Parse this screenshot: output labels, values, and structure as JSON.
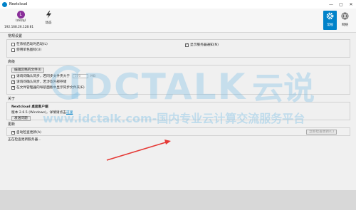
{
  "window": {
    "title": "Nextcloud",
    "controls": [
      "—",
      "▢",
      "✕"
    ]
  },
  "toolbar": {
    "account": {
      "avatar_letter": "L",
      "name": "lzlilzql",
      "host": "192.168.26.128:81"
    },
    "activity_label": "动态",
    "general_label": "常规",
    "network_label": "网络"
  },
  "general_settings": {
    "title": "常规设置",
    "launch_on_start": "在系统启动时启动(L)",
    "use_mono_icons": "使用单色图标(U)",
    "show_server_notifications": "显示服务器通知(N)"
  },
  "advanced": {
    "title": "高级",
    "edit_ignored_files": "编辑忽略的文件(I)",
    "ask_confirm_label": "请询问确认同步，若同步文件夹大于",
    "size_value": "500",
    "size_unit": "MB",
    "ask_external_storage": "请询问确认同步，若涉及外部存储",
    "show_sync_in_explorer": "在文件管理器的导航面板中显示同步文件夹(E)"
  },
  "about": {
    "title": "关于",
    "product": "Nextcloud 桌面客户端",
    "version_text": "版本 2.6.5 (Windows)，详情请点击",
    "here_link": "这里",
    "issue_button": "发送问题"
  },
  "updates": {
    "title": "更新",
    "auto_check": "自动检查更新(A)",
    "check_now_button": "立即检查更新(C)",
    "status": "正在检查更新服务器..."
  },
  "watermark": {
    "brand": "IDCTALK",
    "brand_cn": "云说",
    "url": "www.idctalk.com-国内专业云计算交流服务平台"
  },
  "colors": {
    "accent": "#0082c9",
    "avatar": "#8a2f9a",
    "annotation": "#e53935"
  }
}
